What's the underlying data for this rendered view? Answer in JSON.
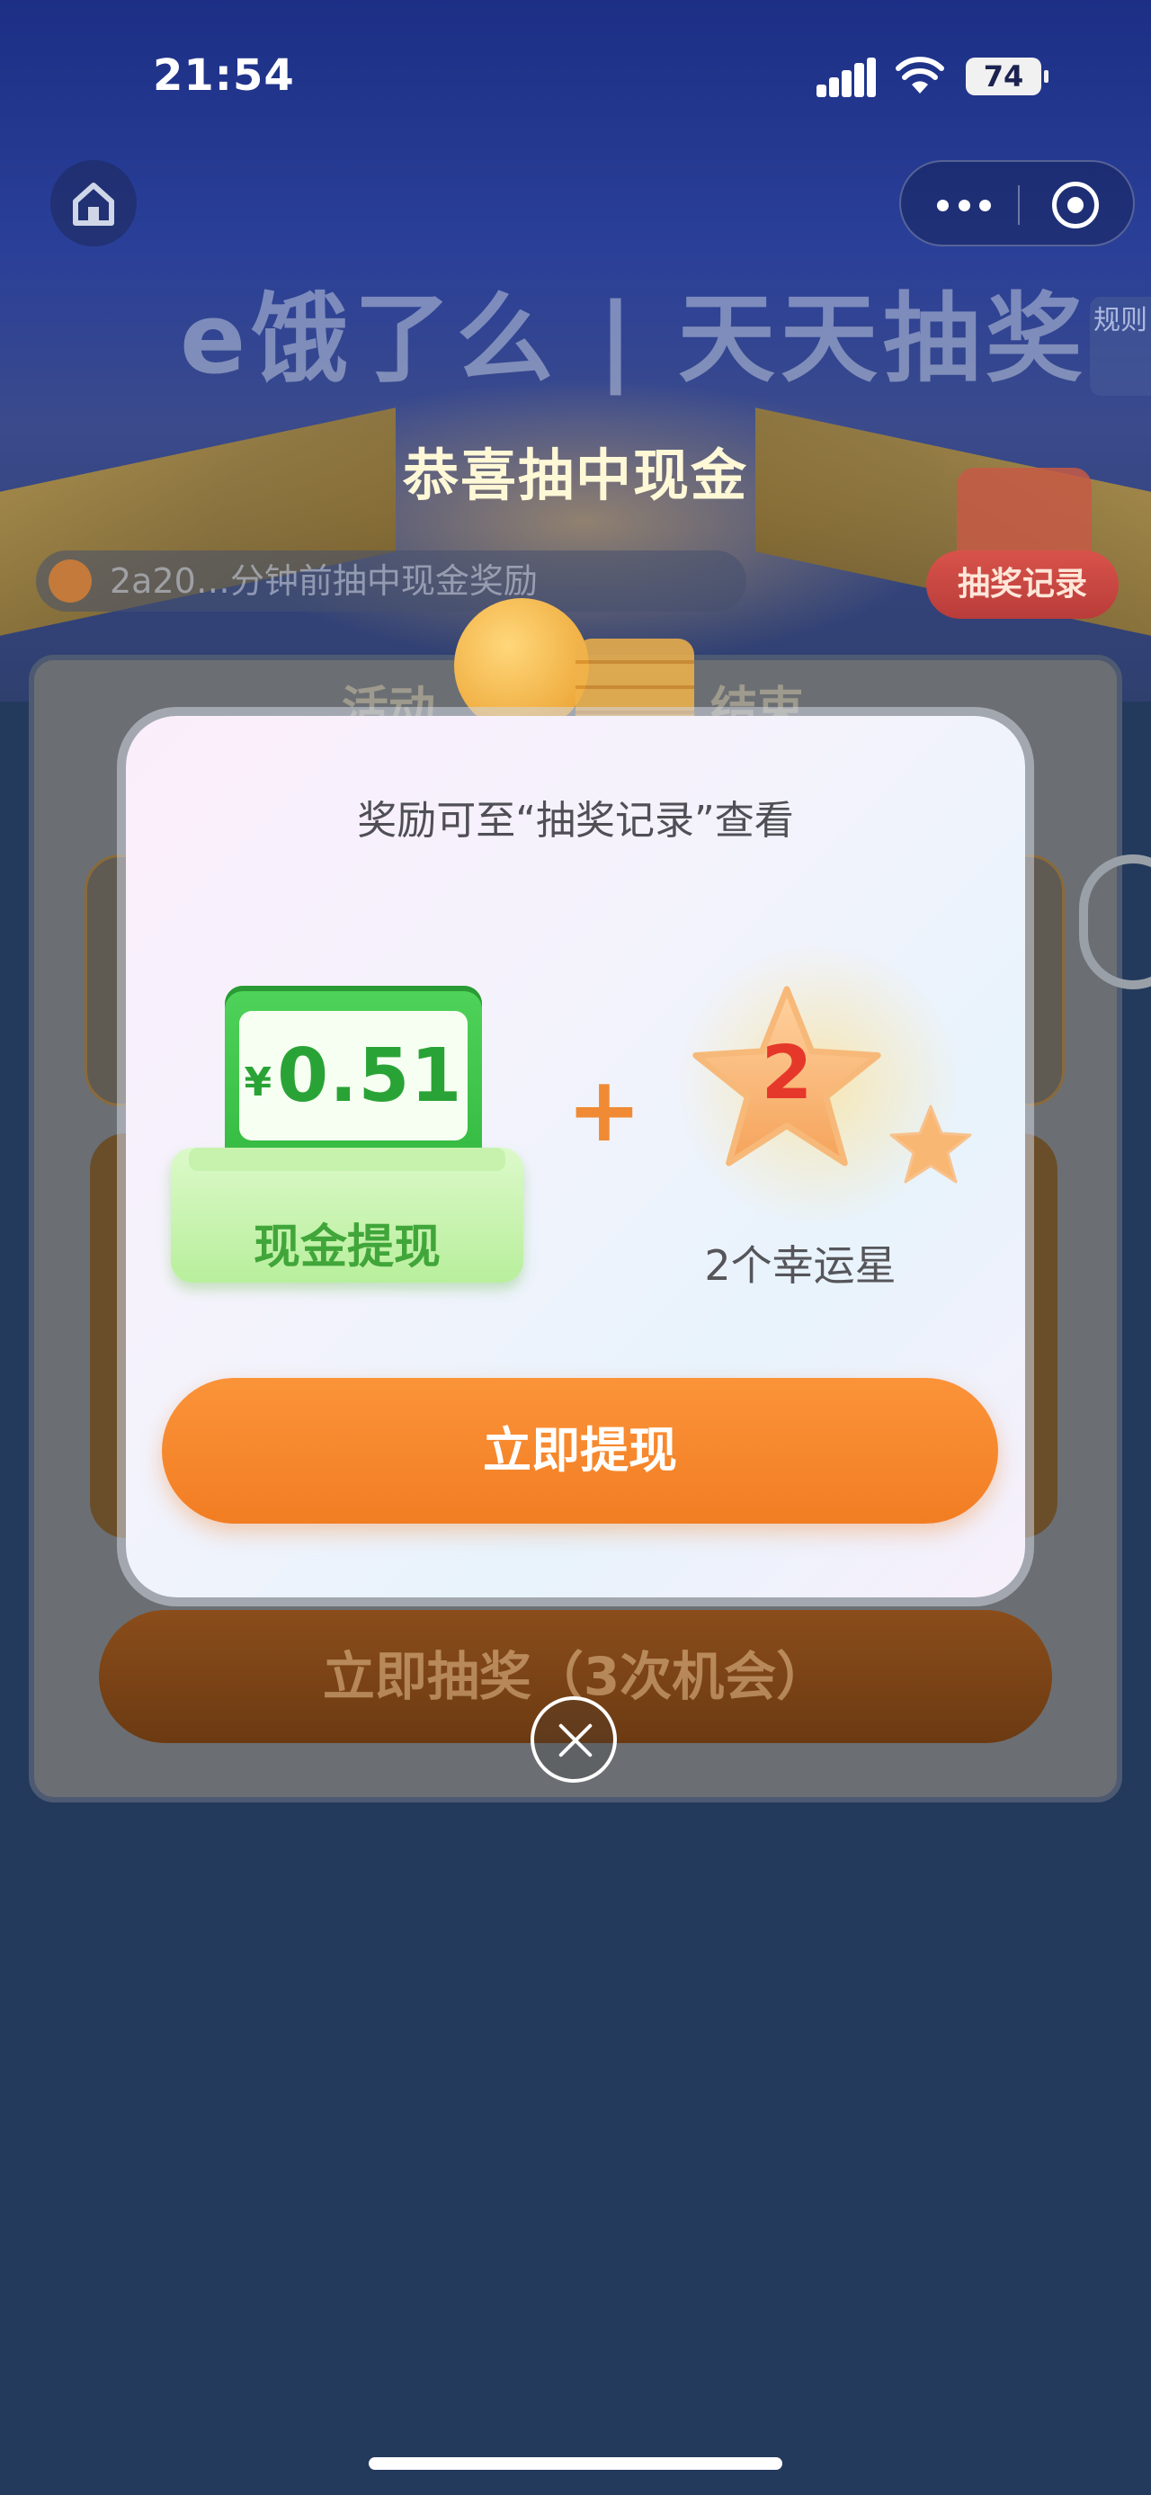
{
  "status_bar": {
    "time": "21:54",
    "battery": "74"
  },
  "nav": {
    "home_icon": "home-icon",
    "more_icon": "more-dots-icon",
    "target_icon": "target-icon",
    "rule_tab": "规则"
  },
  "brand": "e饿了么 | 天天抽奖",
  "background": {
    "headline": "恭喜抽中现金",
    "ticker_text": "2a20…分钟前抽中现金奖励",
    "record_button": "抽奖记录",
    "activity_left": "活动",
    "activity_right": "结束",
    "draw_button": "立即抽奖（3次机会）"
  },
  "modal": {
    "subtitle": "奖励可至“抽奖记录”查看",
    "cash_currency": "¥",
    "cash_amount": "0.51",
    "cash_label": "现金提现",
    "plus": "+",
    "star_count": "2",
    "star_label": "2个幸运星",
    "withdraw_button": "立即提现",
    "close_icon": "close-icon"
  },
  "colors": {
    "accent_orange": "#f58529",
    "cash_green": "#2fb43d",
    "star_red": "#e5382a"
  }
}
